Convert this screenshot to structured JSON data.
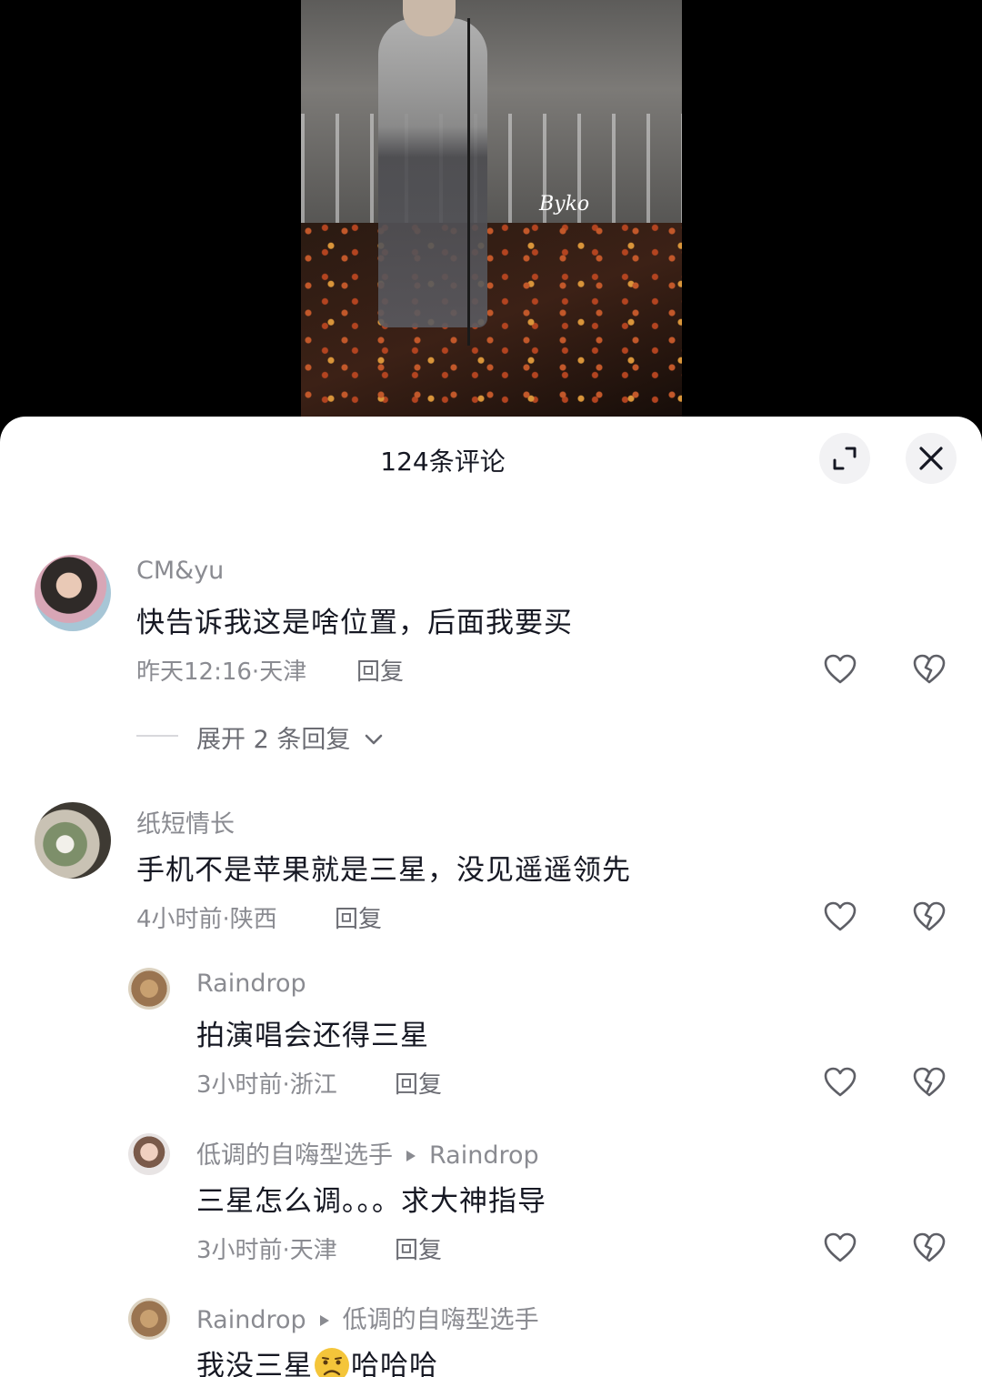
{
  "video": {
    "watermark": "Byko"
  },
  "panel": {
    "title": "124条评论"
  },
  "comments": [
    {
      "user": "CM&yu",
      "text": "快告诉我这是啥位置，后面我要买",
      "meta": "昨天12:16·天津",
      "reply_label": "回复",
      "expand_label": "展开 2 条回复"
    },
    {
      "user": "纸短情长",
      "text": "手机不是苹果就是三星，没见遥遥领先",
      "meta": "4小时前·陕西",
      "reply_label": "回复"
    }
  ],
  "replies": [
    {
      "user": "Raindrop",
      "text": "拍演唱会还得三星",
      "meta": "3小时前·浙江",
      "reply_label": "回复"
    },
    {
      "user": "低调的自嗨型选手",
      "reply_to": "Raindrop",
      "text": "三星怎么调。。。求大神指导",
      "meta": "3小时前·天津",
      "reply_label": "回复"
    },
    {
      "user": "Raindrop",
      "reply_to": "低调的自嗨型选手",
      "text_before": "我没三星",
      "text_after": "哈哈哈",
      "emoji": "sad-face-emoji"
    }
  ],
  "icons": {
    "expand": "expand-icon",
    "close": "close-icon",
    "like": "heart-outline-icon",
    "dislike": "broken-heart-icon",
    "chevron": "chevron-down-icon",
    "arrow": "play-arrow-icon"
  },
  "colors": {
    "primary_text": "#161823",
    "secondary_text": "#8a8b91",
    "panel_bg": "#ffffff",
    "backdrop": "#000000"
  }
}
